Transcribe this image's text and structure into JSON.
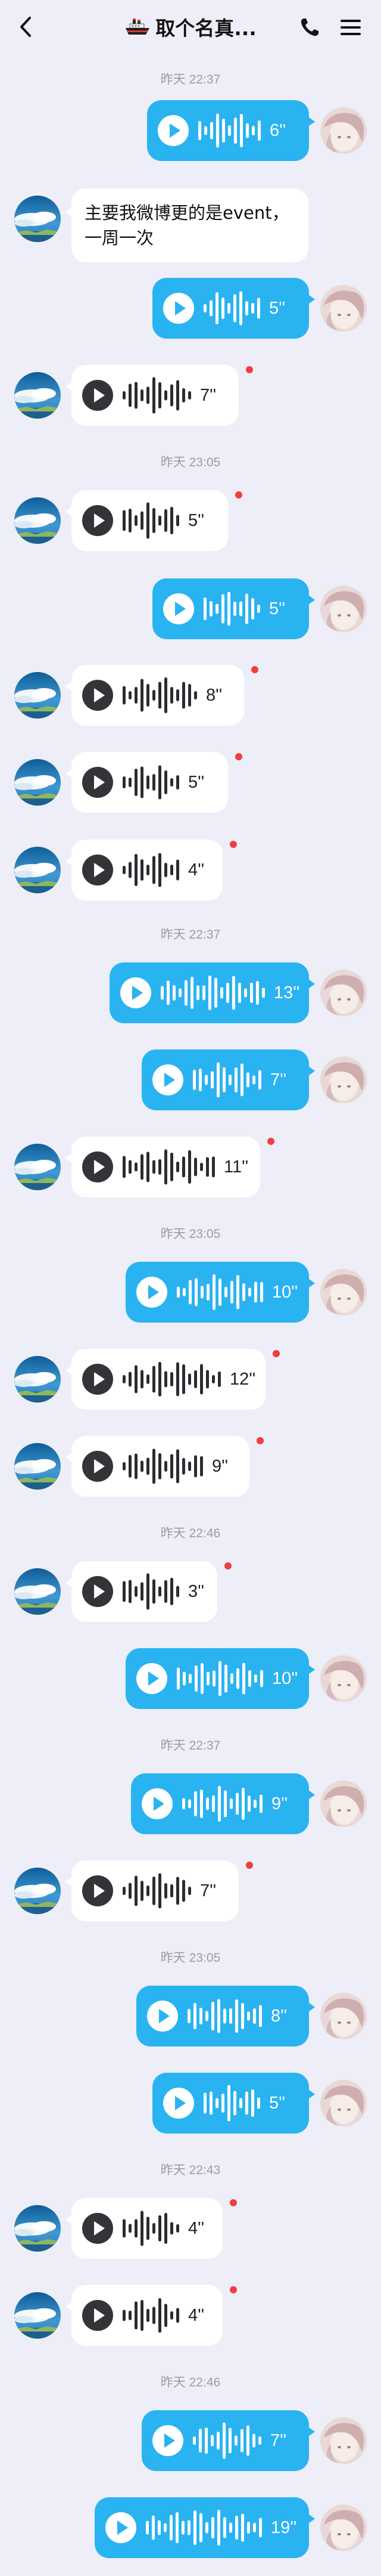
{
  "header": {
    "title": "取个名真...",
    "back_icon": "back-arrow-icon",
    "title_icon": "boat-icon",
    "call_icon": "phone-icon",
    "menu_icon": "menu-icon"
  },
  "colors": {
    "background": "#edeef7",
    "outgoing_bubble": "#2ab3f1",
    "incoming_bubble": "#ffffff",
    "unread_dot": "#f03e3e",
    "timestamp": "#9a9ba6"
  },
  "messages": [
    {
      "kind": "time",
      "text": "昨天 22:37"
    },
    {
      "kind": "voice",
      "dir": "out",
      "duration": "6''",
      "unread": false
    },
    {
      "kind": "text",
      "dir": "in",
      "text": "主要我微博更的是event，一周一次"
    },
    {
      "kind": "voice",
      "dir": "out",
      "duration": "5''",
      "unread": false
    },
    {
      "kind": "voice",
      "dir": "in",
      "duration": "7''",
      "unread": true
    },
    {
      "kind": "time",
      "text": "昨天 23:05"
    },
    {
      "kind": "voice",
      "dir": "in",
      "duration": "5''",
      "unread": true
    },
    {
      "kind": "voice",
      "dir": "out",
      "duration": "5''",
      "unread": false
    },
    {
      "kind": "voice",
      "dir": "in",
      "duration": "8''",
      "unread": true
    },
    {
      "kind": "voice",
      "dir": "in",
      "duration": "5''",
      "unread": true
    },
    {
      "kind": "voice",
      "dir": "in",
      "duration": "4''",
      "unread": true
    },
    {
      "kind": "time",
      "text": "昨天 22:37"
    },
    {
      "kind": "voice",
      "dir": "out",
      "duration": "13''",
      "unread": false
    },
    {
      "kind": "voice",
      "dir": "out",
      "duration": "7''",
      "unread": false
    },
    {
      "kind": "voice",
      "dir": "in",
      "duration": "11''",
      "unread": true
    },
    {
      "kind": "time",
      "text": "昨天 23:05"
    },
    {
      "kind": "voice",
      "dir": "out",
      "duration": "10''",
      "unread": false
    },
    {
      "kind": "voice",
      "dir": "in",
      "duration": "12''",
      "unread": true
    },
    {
      "kind": "voice",
      "dir": "in",
      "duration": "9''",
      "unread": true
    },
    {
      "kind": "time",
      "text": "昨天 22:46"
    },
    {
      "kind": "voice",
      "dir": "in",
      "duration": "3''",
      "unread": true
    },
    {
      "kind": "voice",
      "dir": "out",
      "duration": "10''",
      "unread": false
    },
    {
      "kind": "time",
      "text": "昨天 22:37"
    },
    {
      "kind": "voice",
      "dir": "out",
      "duration": "9''",
      "unread": false
    },
    {
      "kind": "voice",
      "dir": "in",
      "duration": "7''",
      "unread": true
    },
    {
      "kind": "time",
      "text": "昨天 23:05"
    },
    {
      "kind": "voice",
      "dir": "out",
      "duration": "8''",
      "unread": false
    },
    {
      "kind": "voice",
      "dir": "out",
      "duration": "5''",
      "unread": false
    },
    {
      "kind": "time",
      "text": "昨天 22:43"
    },
    {
      "kind": "voice",
      "dir": "in",
      "duration": "4''",
      "unread": true
    },
    {
      "kind": "voice",
      "dir": "in",
      "duration": "4''",
      "unread": true
    },
    {
      "kind": "time",
      "text": "昨天 22:46"
    },
    {
      "kind": "voice",
      "dir": "out",
      "duration": "7''",
      "unread": false
    },
    {
      "kind": "voice",
      "dir": "out",
      "duration": "19''",
      "unread": false
    }
  ]
}
